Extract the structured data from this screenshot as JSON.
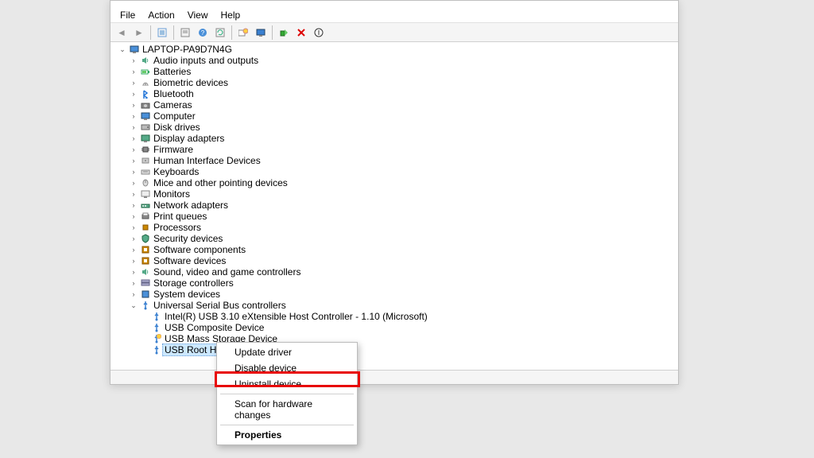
{
  "menubar": {
    "file": "File",
    "action": "Action",
    "view": "View",
    "help": "Help"
  },
  "root": {
    "computer": "LAPTOP-PA9D7N4G"
  },
  "categories": [
    {
      "label": "Audio inputs and outputs",
      "icon": "speaker"
    },
    {
      "label": "Batteries",
      "icon": "battery"
    },
    {
      "label": "Biometric devices",
      "icon": "finger"
    },
    {
      "label": "Bluetooth",
      "icon": "bluetooth"
    },
    {
      "label": "Cameras",
      "icon": "camera"
    },
    {
      "label": "Computer",
      "icon": "monitor"
    },
    {
      "label": "Disk drives",
      "icon": "disk"
    },
    {
      "label": "Display adapters",
      "icon": "display"
    },
    {
      "label": "Firmware",
      "icon": "chip"
    },
    {
      "label": "Human Interface Devices",
      "icon": "hid"
    },
    {
      "label": "Keyboards",
      "icon": "keyboard"
    },
    {
      "label": "Mice and other pointing devices",
      "icon": "mouse"
    },
    {
      "label": "Monitors",
      "icon": "monitor2"
    },
    {
      "label": "Network adapters",
      "icon": "network"
    },
    {
      "label": "Print queues",
      "icon": "printer"
    },
    {
      "label": "Processors",
      "icon": "cpu"
    },
    {
      "label": "Security devices",
      "icon": "shield"
    },
    {
      "label": "Software components",
      "icon": "sw"
    },
    {
      "label": "Software devices",
      "icon": "sw"
    },
    {
      "label": "Sound, video and game controllers",
      "icon": "speaker"
    },
    {
      "label": "Storage controllers",
      "icon": "storage"
    },
    {
      "label": "System devices",
      "icon": "system"
    }
  ],
  "usb": {
    "category": "Universal Serial Bus controllers",
    "items": [
      "Intel(R) USB 3.10 eXtensible Host Controller - 1.10 (Microsoft)",
      "USB Composite Device",
      "USB Mass Storage Device",
      "USB Root Hub ("
    ]
  },
  "context_menu": {
    "update": "Update driver",
    "disable": "Disable device",
    "uninstall": "Uninstall device",
    "scan": "Scan for hardware changes",
    "properties": "Properties"
  }
}
